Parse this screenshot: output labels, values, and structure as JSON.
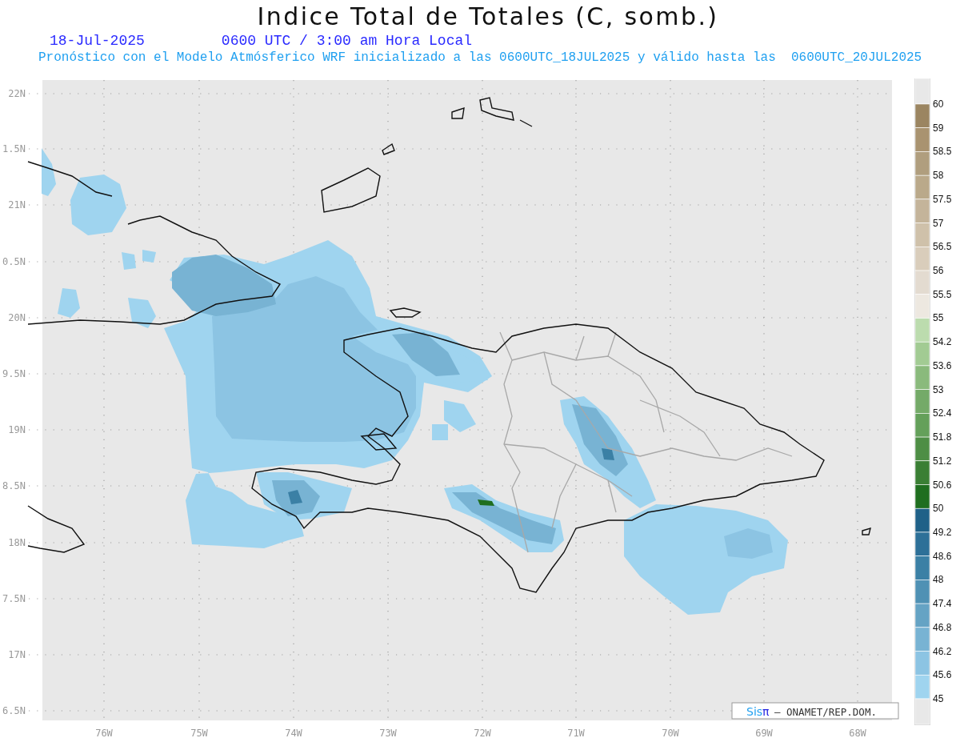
{
  "title": "Indice Total de Totales (C, somb.)",
  "date": "18-Jul-2025",
  "time": "0600 UTC / 3:00 am Hora Local",
  "description": "Pronóstico con el Modelo Atmósferico WRF inicializado a las 0600UTC_18JUL2025 y válido hasta las  0600UTC_20JUL2025",
  "lat_labels": [
    "22N",
    "1.5N",
    "21N",
    "0.5N",
    "20N",
    "9.5N",
    "19N",
    "8.5N",
    "18N",
    "7.5N",
    "17N",
    "6.5N"
  ],
  "lon_labels": [
    "76W",
    "75W",
    "74W",
    "73W",
    "72W",
    "71W",
    "70W",
    "69W",
    "68W"
  ],
  "colorbar": {
    "labels": [
      "60",
      "59",
      "58.5",
      "58",
      "57.5",
      "57",
      "56.5",
      "56",
      "55.5",
      "55",
      "54.2",
      "53.6",
      "53",
      "52.4",
      "51.8",
      "51.2",
      "50.6",
      "50",
      "49.2",
      "48.6",
      "48",
      "47.4",
      "46.8",
      "46.2",
      "45.6",
      "45"
    ],
    "segments": [
      {
        "color": "#e8e8e8"
      },
      {
        "color": "#9b8561"
      },
      {
        "color": "#a99370"
      },
      {
        "color": "#b09e7e"
      },
      {
        "color": "#baa98a"
      },
      {
        "color": "#c4b49a"
      },
      {
        "color": "#cfc1aa"
      },
      {
        "color": "#d9cdbb"
      },
      {
        "color": "#e3dbd0"
      },
      {
        "color": "#ede8e0"
      },
      {
        "color": "#bcdcae"
      },
      {
        "color": "#a2cb93"
      },
      {
        "color": "#8aba7c"
      },
      {
        "color": "#74aa68"
      },
      {
        "color": "#64a05a"
      },
      {
        "color": "#4e8e45"
      },
      {
        "color": "#3a7f34"
      },
      {
        "color": "#1f6e1f"
      },
      {
        "color": "#1f6188"
      },
      {
        "color": "#2d7098"
      },
      {
        "color": "#3b80a5"
      },
      {
        "color": "#4f91b4"
      },
      {
        "color": "#65a3c4"
      },
      {
        "color": "#78b3d3"
      },
      {
        "color": "#8cc4e3"
      },
      {
        "color": "#9fd4ef"
      },
      {
        "color": "#e8e8e8"
      }
    ]
  },
  "logo": {
    "brand": "Sis",
    "symbol": "π",
    "credit": "– ONAMET/REP.DOM."
  }
}
